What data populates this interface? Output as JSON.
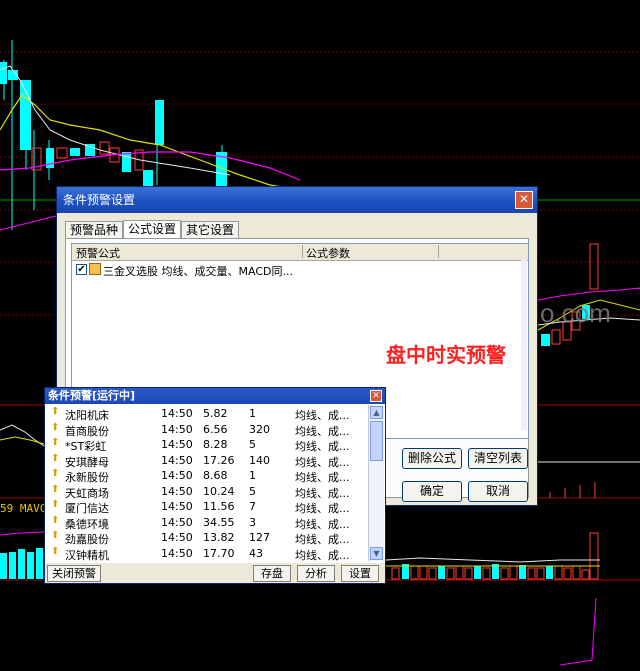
{
  "watermark": "o.com",
  "mavc_label": "59 MAVC",
  "settings_dialog": {
    "title": "条件预警设置",
    "close_symbol": "✕",
    "tabs": [
      "预警品种",
      "公式设置",
      "其它设置"
    ],
    "active_tab": "公式设置",
    "list_headers": [
      "预警公式",
      "公式参数"
    ],
    "formula_row": "三金叉选股 均线、成交量、MACD同...",
    "formula_checked": true,
    "annotation": "盘中时实预警",
    "buttons": {
      "delete": "删除公式",
      "clear": "清空列表",
      "ok": "确定",
      "cancel": "取消"
    }
  },
  "alert_window": {
    "title": "条件预警[运行中]",
    "close_symbol": "✕",
    "rows": [
      {
        "name": "沈阳机床",
        "time": "14:50",
        "price": "5.82",
        "volume": "1",
        "desc": "均线、成..."
      },
      {
        "name": "首商股份",
        "time": "14:50",
        "price": "6.56",
        "volume": "320",
        "desc": "均线、成..."
      },
      {
        "name": "*ST彩虹",
        "time": "14:50",
        "price": "8.28",
        "volume": "5",
        "desc": "均线、成..."
      },
      {
        "name": "安琪酵母",
        "time": "14:50",
        "price": "17.26",
        "volume": "140",
        "desc": "均线、成..."
      },
      {
        "name": "永新股份",
        "time": "14:50",
        "price": "8.68",
        "volume": "1",
        "desc": "均线、成..."
      },
      {
        "name": "天虹商场",
        "time": "14:50",
        "price": "10.24",
        "volume": "5",
        "desc": "均线、成..."
      },
      {
        "name": "厦门信达",
        "time": "14:50",
        "price": "11.56",
        "volume": "7",
        "desc": "均线、成..."
      },
      {
        "name": "桑德环境",
        "time": "14:50",
        "price": "34.55",
        "volume": "3",
        "desc": "均线、成..."
      },
      {
        "name": "劲嘉股份",
        "time": "14:50",
        "price": "13.82",
        "volume": "127",
        "desc": "均线、成..."
      },
      {
        "name": "汉钟精机",
        "time": "14:50",
        "price": "17.70",
        "volume": "43",
        "desc": "均线、成..."
      }
    ],
    "buttons": {
      "close": "关闭预警",
      "save": "存盘",
      "analyze": "分析",
      "settings": "设置"
    }
  },
  "colors": {
    "candle_up": "#00ffff",
    "candle_down_outline": "#ff3c3c",
    "ma_yellow": "#e0e000",
    "ma_magenta": "#ff00ff",
    "ma_green": "#00c000",
    "dialog_title": "#1c4fc0",
    "annotation_red": "#ff2020"
  }
}
